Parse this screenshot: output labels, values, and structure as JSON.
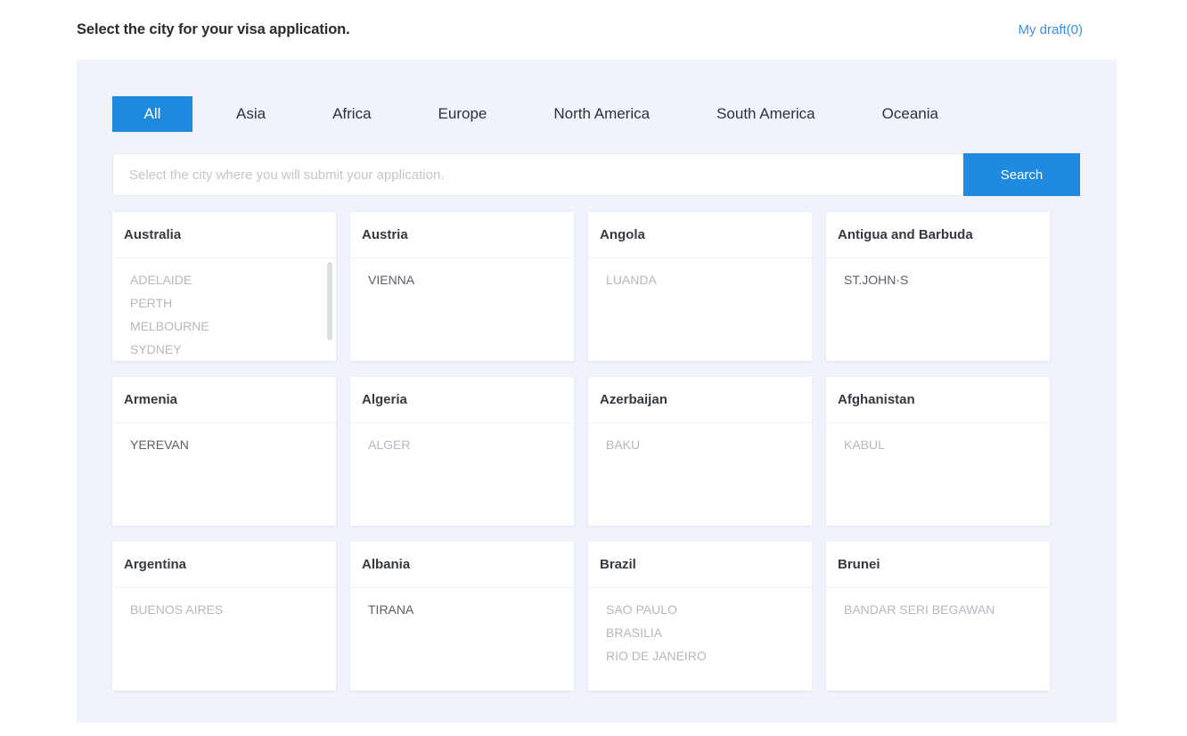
{
  "header": {
    "title": "Select the city for your visa application.",
    "draft_link": "My draft(0)"
  },
  "tabs": [
    {
      "label": "All",
      "active": true
    },
    {
      "label": "Asia",
      "active": false
    },
    {
      "label": "Africa",
      "active": false
    },
    {
      "label": "Europe",
      "active": false
    },
    {
      "label": "North America",
      "active": false
    },
    {
      "label": "South America",
      "active": false
    },
    {
      "label": "Oceania",
      "active": false
    }
  ],
  "search": {
    "value": "",
    "placeholder": "Select the city where you will submit your application.",
    "button_label": "Search"
  },
  "colors": {
    "accent": "#2089e0",
    "panel_bg": "#f0f3fc",
    "card_bg": "#ffffff",
    "link": "#3e8ede",
    "city_text": "#b5b8bf",
    "title_text": "#353a42"
  },
  "cards": [
    {
      "country": "Australia",
      "cities": [
        "ADELAIDE",
        "PERTH",
        "MELBOURNE",
        "SYDNEY"
      ],
      "scrollable": true,
      "highlight_first": false
    },
    {
      "country": "Austria",
      "cities": [
        "VIENNA"
      ],
      "scrollable": false,
      "highlight_first": true
    },
    {
      "country": "Angola",
      "cities": [
        "LUANDA"
      ],
      "scrollable": false,
      "highlight_first": false
    },
    {
      "country": "Antigua and Barbuda",
      "cities": [
        "ST.JOHN·S"
      ],
      "scrollable": false,
      "highlight_first": true
    },
    {
      "country": "Armenia",
      "cities": [
        "YEREVAN"
      ],
      "scrollable": false,
      "highlight_first": true
    },
    {
      "country": "Algeria",
      "cities": [
        "ALGER"
      ],
      "scrollable": false,
      "highlight_first": false
    },
    {
      "country": "Azerbaijan",
      "cities": [
        "BAKU"
      ],
      "scrollable": false,
      "highlight_first": false
    },
    {
      "country": "Afghanistan",
      "cities": [
        "KABUL"
      ],
      "scrollable": false,
      "highlight_first": false
    },
    {
      "country": "Argentina",
      "cities": [
        "BUENOS AIRES"
      ],
      "scrollable": false,
      "highlight_first": false
    },
    {
      "country": "Albania",
      "cities": [
        "TIRANA"
      ],
      "scrollable": false,
      "highlight_first": true
    },
    {
      "country": "Brazil",
      "cities": [
        "SAO PAULO",
        "BRASILIA",
        "RIO DE JANEIRO"
      ],
      "scrollable": false,
      "highlight_first": false
    },
    {
      "country": "Brunei",
      "cities": [
        "BANDAR SERI BEGAWAN"
      ],
      "scrollable": false,
      "highlight_first": false
    }
  ]
}
